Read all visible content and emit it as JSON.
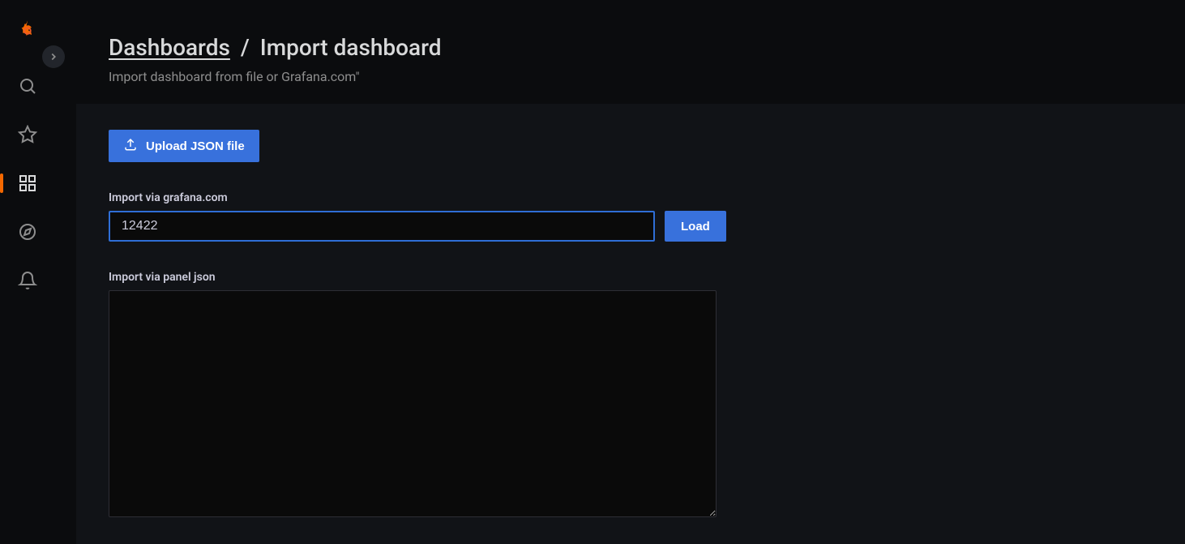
{
  "breadcrumb": {
    "parent": "Dashboards",
    "separator": "/",
    "current": "Import dashboard"
  },
  "subtitle": "Import dashboard from file or Grafana.com\"",
  "upload_button_label": "Upload JSON file",
  "grafana_com": {
    "label": "Import via grafana.com",
    "value": "12422",
    "load_label": "Load"
  },
  "panel_json": {
    "label": "Import via panel json",
    "value": ""
  }
}
